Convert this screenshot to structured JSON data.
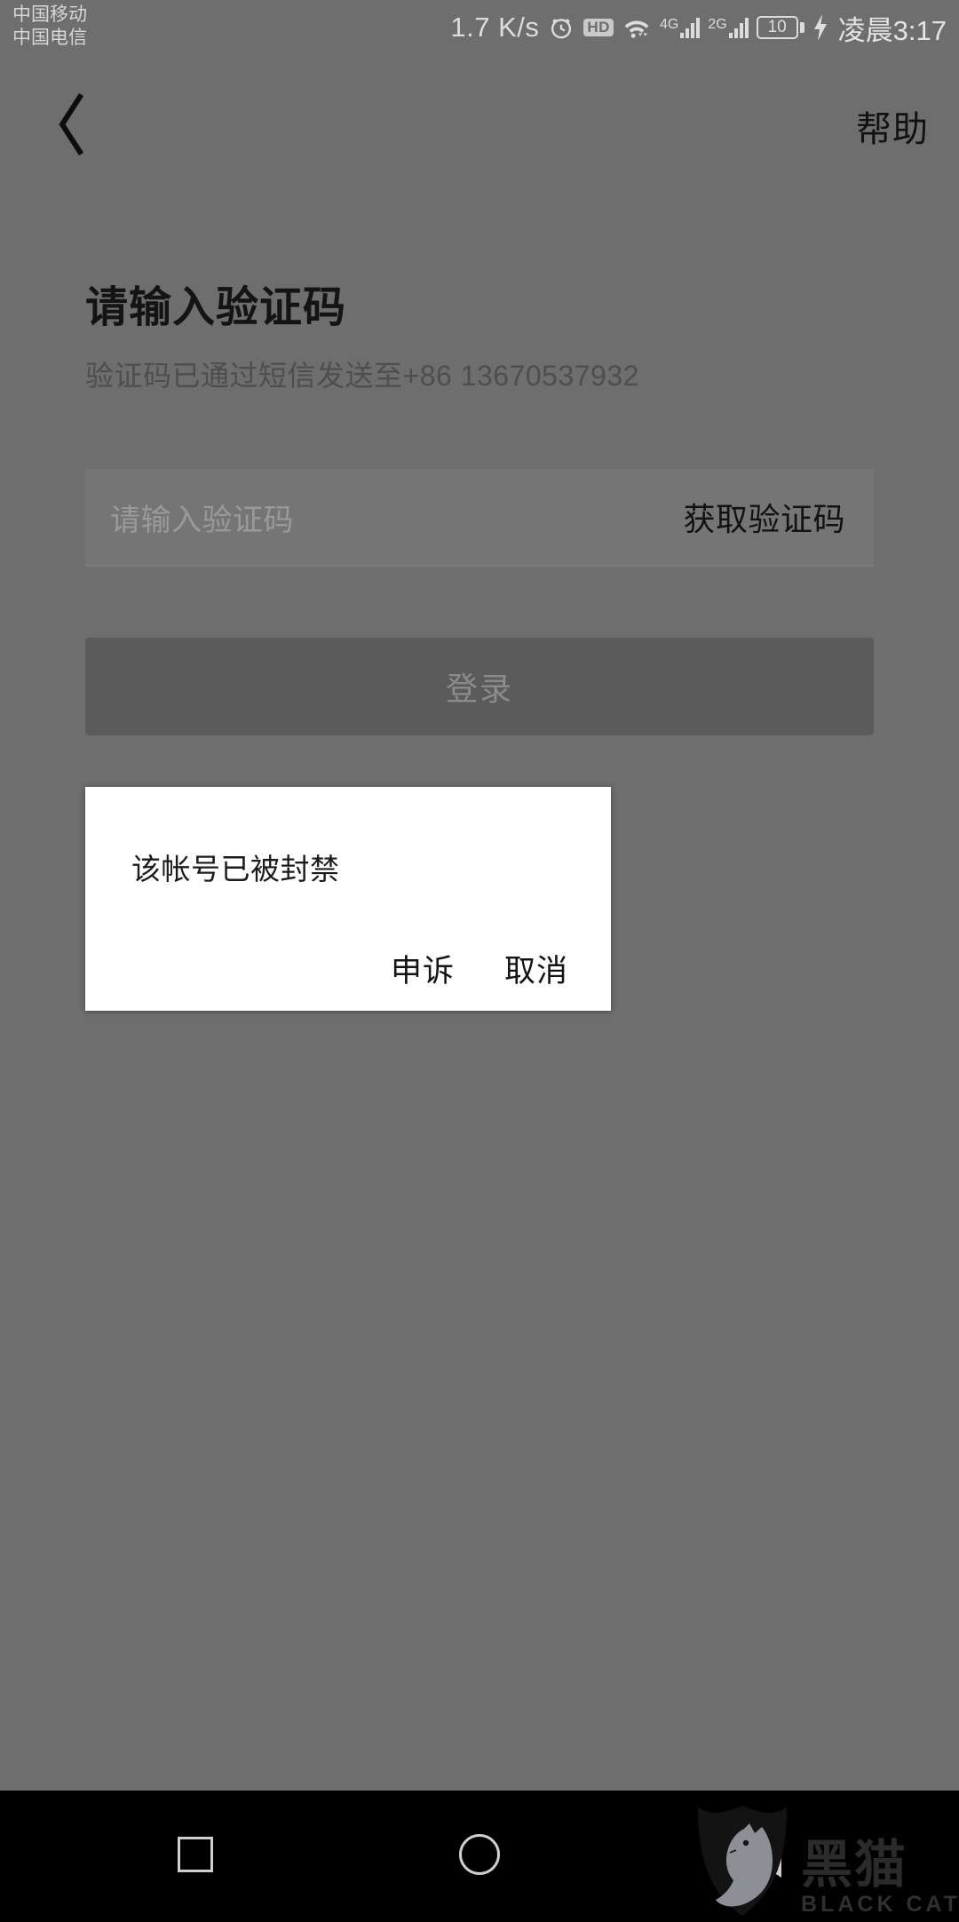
{
  "status_bar": {
    "carrier_primary": "中国移动",
    "carrier_secondary": "中国电信",
    "net_speed": "1.7 K/s",
    "alarm_icon": "alarm-clock-icon",
    "hd_badge": "HD",
    "wifi_icon": "wifi-icon",
    "signal_1_gen": "4G",
    "signal_2_gen": "2G",
    "battery_level": "10",
    "charging_icon": "lightning-bolt-icon",
    "clock": "凌晨3:17"
  },
  "app_bar": {
    "back_icon": "chevron-left-icon",
    "help_label": "帮助"
  },
  "main": {
    "title": "请输入验证码",
    "subtitle": "验证码已通过短信发送至+86 13670537932",
    "code_input_placeholder": "请输入验证码",
    "code_input_value": "",
    "get_code_label": "获取验证码",
    "login_label": "登录"
  },
  "dialog": {
    "message": "该帐号已被封禁",
    "appeal_label": "申诉",
    "cancel_label": "取消"
  },
  "nav_bar": {
    "recents_icon": "square-recents-icon",
    "home_icon": "circle-home-icon",
    "back_icon": "triangle-back-icon"
  },
  "watermark": {
    "cn_text": "黑猫",
    "en_text": "BLACK CAT",
    "logo_icon": "black-cat-shield-icon"
  },
  "colors": {
    "scrim": "#6e6e6e",
    "dialog_bg": "#ffffff",
    "nav_bg": "#000000",
    "text_primary": "#141414",
    "text_muted": "#9a9a9a",
    "button_disabled": "#5b5b5b"
  }
}
